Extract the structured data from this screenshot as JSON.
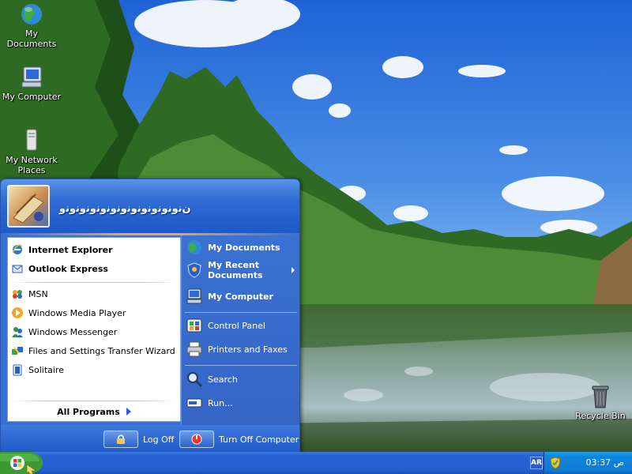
{
  "desktop": {
    "icons": [
      {
        "label": "My Documents",
        "icon": "globe-icon"
      },
      {
        "label": "My Computer",
        "icon": "computer-icon"
      },
      {
        "label": "My Network Places",
        "icon": "network-icon"
      },
      {
        "label": "Recycle Bin",
        "icon": "recycle-bin-icon"
      }
    ]
  },
  "start_menu": {
    "user_name": "ﻥﻧﻭﻧﻭﻧﻭﻧﻭﻧﻭﻧﻭﻧﻭﻧﻭﻧﻭﻧﻭﻧﻭﻧﻭ",
    "pinned": [
      {
        "label": "Internet Explorer",
        "icon": "internet-explorer-icon"
      },
      {
        "label": "Outlook Express",
        "icon": "outlook-express-icon"
      }
    ],
    "recent": [
      {
        "label": "MSN",
        "icon": "msn-icon"
      },
      {
        "label": "Windows Media Player",
        "icon": "media-player-icon"
      },
      {
        "label": "Windows Messenger",
        "icon": "messenger-icon"
      },
      {
        "label": "Files and Settings Transfer Wizard",
        "icon": "transfer-wizard-icon"
      },
      {
        "label": "Solitaire",
        "icon": "solitaire-icon"
      }
    ],
    "all_programs": "All Programs",
    "right": {
      "my_documents": "My Documents",
      "my_recent_documents": "My Recent Documents",
      "my_computer": "My Computer",
      "control_panel": "Control Panel",
      "printers_and_faxes": "Printers and Faxes",
      "search": "Search",
      "run": "Run..."
    },
    "footer": {
      "log_off": "Log Off",
      "turn_off": "Turn Off Computer"
    }
  },
  "taskbar": {
    "language": "AR",
    "clock": "03:37 ص"
  },
  "colors": {
    "start_blue": "#3a70d0",
    "taskbar_blue": "#245dd0",
    "tray_blue": "#0e7ad4",
    "start_green": "#3c9a35"
  }
}
